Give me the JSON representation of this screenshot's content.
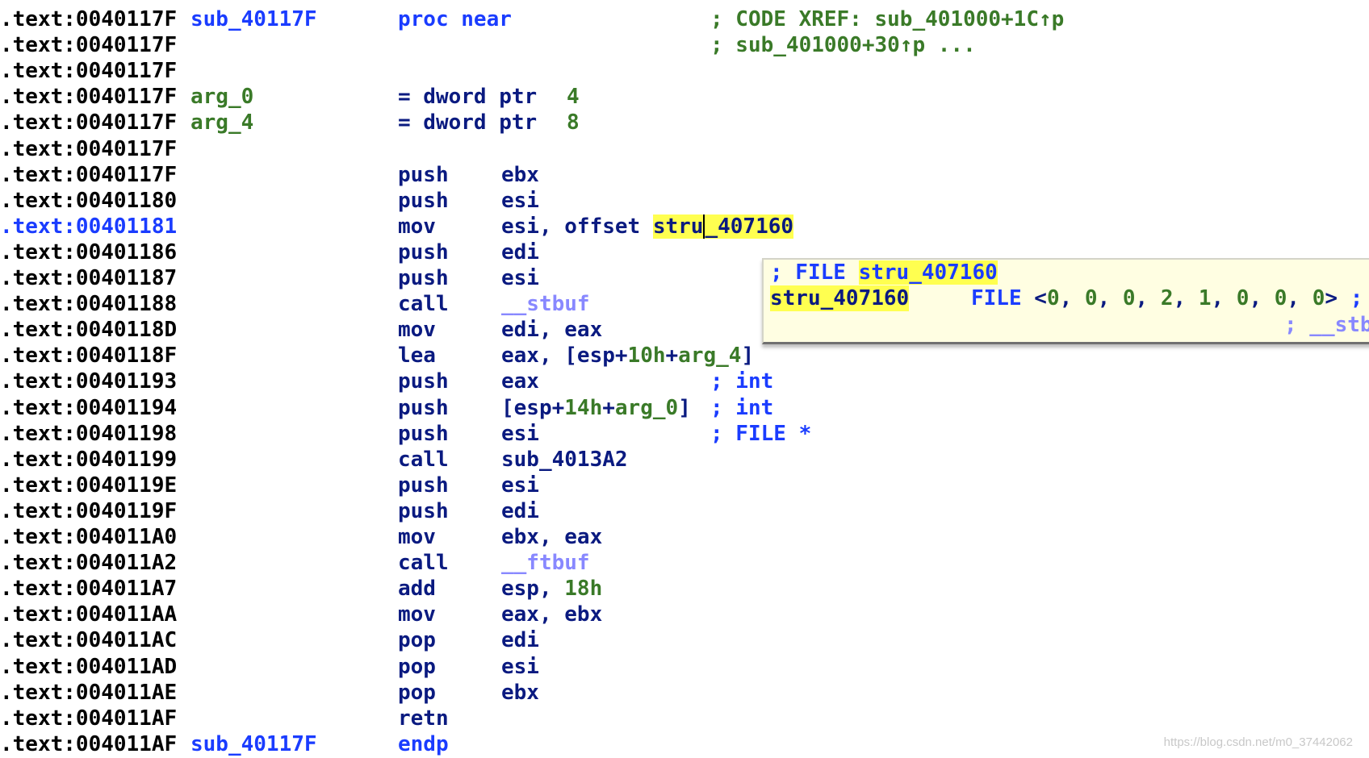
{
  "colors": {
    "address": "#000000",
    "current_address": "#1a3cff",
    "name": "#1a3cff",
    "mnemonic": "#0a1a80",
    "number": "#3a7a28",
    "comment": "#3a7a28",
    "type_comment": "#1a3cff",
    "library_function": "#8888ff",
    "highlight": "#ffff50",
    "tooltip_bg": "#fffee2"
  },
  "listing": [
    {
      "addr": ".text:0040117F",
      "name": {
        "t": "sub_40117F",
        "c": "name"
      },
      "mnem": {
        "t": "proc near",
        "c": "kw"
      },
      "ops": [],
      "comment": {
        "t": "; CODE XREF: sub_401000+1C↑p",
        "c": "green"
      }
    },
    {
      "addr": ".text:0040117F",
      "ops": [],
      "comment": {
        "t": "; sub_401000+30↑p ...",
        "c": "green"
      }
    },
    {
      "addr": ".text:0040117F",
      "ops": []
    },
    {
      "addr": ".text:0040117F",
      "name": {
        "t": "arg_0",
        "c": "green"
      },
      "mnem": {
        "t": "= dword ptr",
        "c": "navy"
      },
      "value": {
        "t": "4",
        "c": "green"
      },
      "ops": []
    },
    {
      "addr": ".text:0040117F",
      "name": {
        "t": "arg_4",
        "c": "green"
      },
      "mnem": {
        "t": "= dword ptr",
        "c": "navy"
      },
      "value": {
        "t": "8",
        "c": "green"
      },
      "ops": []
    },
    {
      "addr": ".text:0040117F",
      "ops": []
    },
    {
      "addr": ".text:0040117F",
      "mnem": {
        "t": "push",
        "c": "navy"
      },
      "ops": [
        {
          "t": "ebx",
          "c": "navy"
        }
      ]
    },
    {
      "addr": ".text:00401180",
      "mnem": {
        "t": "push",
        "c": "navy"
      },
      "ops": [
        {
          "t": "esi",
          "c": "navy"
        }
      ]
    },
    {
      "addr": ".text:00401181",
      "current": true,
      "mnem": {
        "t": "mov",
        "c": "navy"
      },
      "ops": [
        {
          "t": "esi, offset ",
          "c": "navy"
        },
        {
          "t": "stru",
          "c": "hl"
        },
        {
          "t": "_407160",
          "c": "hl",
          "caret": true
        }
      ]
    },
    {
      "addr": ".text:00401186",
      "mnem": {
        "t": "push",
        "c": "navy"
      },
      "ops": [
        {
          "t": "edi",
          "c": "navy"
        }
      ]
    },
    {
      "addr": ".text:00401187",
      "mnem": {
        "t": "push",
        "c": "navy"
      },
      "ops": [
        {
          "t": "esi",
          "c": "navy"
        }
      ]
    },
    {
      "addr": ".text:00401188",
      "mnem": {
        "t": "call",
        "c": "navy"
      },
      "ops": [
        {
          "t": "__stbuf",
          "c": "lib"
        }
      ]
    },
    {
      "addr": ".text:0040118D",
      "mnem": {
        "t": "mov",
        "c": "navy"
      },
      "ops": [
        {
          "t": "edi, eax",
          "c": "navy"
        }
      ]
    },
    {
      "addr": ".text:0040118F",
      "mnem": {
        "t": "lea",
        "c": "navy"
      },
      "ops": [
        {
          "t": "eax, [esp+",
          "c": "navy"
        },
        {
          "t": "10h",
          "c": "green"
        },
        {
          "t": "+",
          "c": "navy"
        },
        {
          "t": "arg_4",
          "c": "green"
        },
        {
          "t": "]",
          "c": "navy"
        }
      ]
    },
    {
      "addr": ".text:00401193",
      "mnem": {
        "t": "push",
        "c": "navy"
      },
      "ops": [
        {
          "t": "eax",
          "c": "navy"
        }
      ],
      "comment": {
        "t": "; int",
        "c": "blue"
      }
    },
    {
      "addr": ".text:00401194",
      "mnem": {
        "t": "push",
        "c": "navy"
      },
      "ops": [
        {
          "t": "[esp+",
          "c": "navy"
        },
        {
          "t": "14h",
          "c": "green"
        },
        {
          "t": "+",
          "c": "navy"
        },
        {
          "t": "arg_0",
          "c": "green"
        },
        {
          "t": "]",
          "c": "navy"
        }
      ],
      "comment": {
        "t": "; int",
        "c": "blue"
      }
    },
    {
      "addr": ".text:00401198",
      "mnem": {
        "t": "push",
        "c": "navy"
      },
      "ops": [
        {
          "t": "esi",
          "c": "navy"
        }
      ],
      "comment": {
        "t": "; FILE *",
        "c": "blue"
      }
    },
    {
      "addr": ".text:00401199",
      "mnem": {
        "t": "call",
        "c": "navy"
      },
      "ops": [
        {
          "t": "sub_4013A2",
          "c": "navy"
        }
      ]
    },
    {
      "addr": ".text:0040119E",
      "mnem": {
        "t": "push",
        "c": "navy"
      },
      "ops": [
        {
          "t": "esi",
          "c": "navy"
        }
      ]
    },
    {
      "addr": ".text:0040119F",
      "mnem": {
        "t": "push",
        "c": "navy"
      },
      "ops": [
        {
          "t": "edi",
          "c": "navy"
        }
      ]
    },
    {
      "addr": ".text:004011A0",
      "mnem": {
        "t": "mov",
        "c": "navy"
      },
      "ops": [
        {
          "t": "ebx, eax",
          "c": "navy"
        }
      ]
    },
    {
      "addr": ".text:004011A2",
      "mnem": {
        "t": "call",
        "c": "navy"
      },
      "ops": [
        {
          "t": "__ftbuf",
          "c": "lib"
        }
      ]
    },
    {
      "addr": ".text:004011A7",
      "mnem": {
        "t": "add",
        "c": "navy"
      },
      "ops": [
        {
          "t": "esp, ",
          "c": "navy"
        },
        {
          "t": "18h",
          "c": "green"
        }
      ]
    },
    {
      "addr": ".text:004011AA",
      "mnem": {
        "t": "mov",
        "c": "navy"
      },
      "ops": [
        {
          "t": "eax, ebx",
          "c": "navy"
        }
      ]
    },
    {
      "addr": ".text:004011AC",
      "mnem": {
        "t": "pop",
        "c": "navy"
      },
      "ops": [
        {
          "t": "edi",
          "c": "navy"
        }
      ]
    },
    {
      "addr": ".text:004011AD",
      "mnem": {
        "t": "pop",
        "c": "navy"
      },
      "ops": [
        {
          "t": "esi",
          "c": "navy"
        }
      ]
    },
    {
      "addr": ".text:004011AE",
      "mnem": {
        "t": "pop",
        "c": "navy"
      },
      "ops": [
        {
          "t": "ebx",
          "c": "navy"
        }
      ]
    },
    {
      "addr": ".text:004011AF",
      "mnem": {
        "t": "retn",
        "c": "navy"
      },
      "ops": []
    },
    {
      "addr": ".text:004011AF",
      "name": {
        "t": "sub_40117F",
        "c": "name"
      },
      "mnem": {
        "t": "endp",
        "c": "kw"
      },
      "ops": []
    }
  ],
  "tooltip": {
    "line1": [
      {
        "t": "; FILE ",
        "c": "blue"
      },
      {
        "t": "stru_407160",
        "c": "hl-blue"
      }
    ],
    "line2_label": {
      "t": "stru_407160",
      "c": "hl"
    },
    "line2_type": {
      "t": "FILE ",
      "c": "blue"
    },
    "line2_value": [
      {
        "t": "<",
        "c": "navy"
      },
      {
        "t": "0",
        "c": "green"
      },
      {
        "t": ", ",
        "c": "navy"
      },
      {
        "t": "0",
        "c": "green"
      },
      {
        "t": ", ",
        "c": "navy"
      },
      {
        "t": "0",
        "c": "green"
      },
      {
        "t": ", ",
        "c": "navy"
      },
      {
        "t": "2",
        "c": "green"
      },
      {
        "t": ", ",
        "c": "navy"
      },
      {
        "t": "1",
        "c": "green"
      },
      {
        "t": ", ",
        "c": "navy"
      },
      {
        "t": "0",
        "c": "green"
      },
      {
        "t": ", ",
        "c": "navy"
      },
      {
        "t": "0",
        "c": "green"
      },
      {
        "t": ", ",
        "c": "navy"
      },
      {
        "t": "0",
        "c": "green"
      },
      {
        "t": "> ",
        "c": "navy"
      },
      {
        "t": ";",
        "c": "blue"
      }
    ],
    "line3": {
      "t": "; __stb",
      "c": "lib"
    }
  },
  "watermark": "https://blog.csdn.net/m0_37442062"
}
